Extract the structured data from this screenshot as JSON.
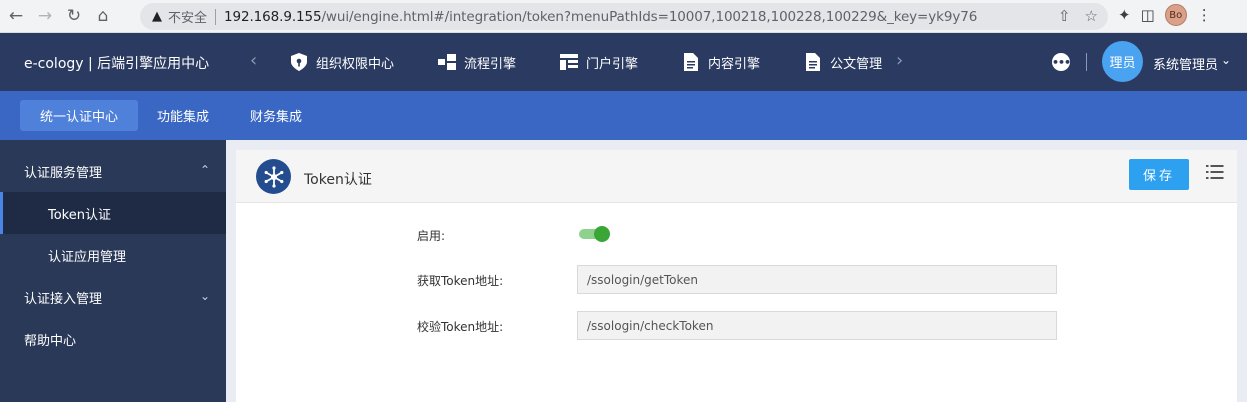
{
  "browser": {
    "security_label": "不安全",
    "url_host": "192.168.9.155",
    "url_path": "/wui/engine.html#/integration/token?menuPathIds=10007,100218,100228,100229&_key=yk9y76",
    "profile_initials": "Bo"
  },
  "header": {
    "brand": "e-cology | 后端引擎应用中心",
    "nav": [
      {
        "label": "组织权限中心",
        "icon": "shield-key-icon"
      },
      {
        "label": "流程引擎",
        "icon": "flow-icon"
      },
      {
        "label": "门户引擎",
        "icon": "portal-icon"
      },
      {
        "label": "内容引擎",
        "icon": "document-icon"
      },
      {
        "label": "公文管理",
        "icon": "document-icon"
      }
    ],
    "avatar_text": "理员",
    "username": "系统管理员"
  },
  "subnav": [
    {
      "label": "统一认证中心",
      "active": true
    },
    {
      "label": "功能集成",
      "active": false
    },
    {
      "label": "财务集成",
      "active": false
    }
  ],
  "sidebar": {
    "items": [
      {
        "label": "认证服务管理",
        "level": "top",
        "expanded": true
      },
      {
        "label": "Token认证",
        "level": "sub",
        "active": true
      },
      {
        "label": "认证应用管理",
        "level": "sub"
      },
      {
        "label": "认证接入管理",
        "level": "top",
        "expanded": false
      },
      {
        "label": "帮助中心",
        "level": "top"
      }
    ]
  },
  "panel": {
    "title": "Token认证",
    "save_label": "保存"
  },
  "form": {
    "enable_label": "启用:",
    "enabled": true,
    "get_token_label": "获取Token地址:",
    "get_token_value": "/ssologin/getToken",
    "check_token_label": "校验Token地址:",
    "check_token_value": "/ssologin/checkToken"
  },
  "colors": {
    "header_bg": "#2b3a61",
    "subnav_bg": "#3a67c4",
    "sidebar_bg": "#2a3957",
    "accent": "#2da0f0",
    "toggle_on": "#3aa636"
  }
}
